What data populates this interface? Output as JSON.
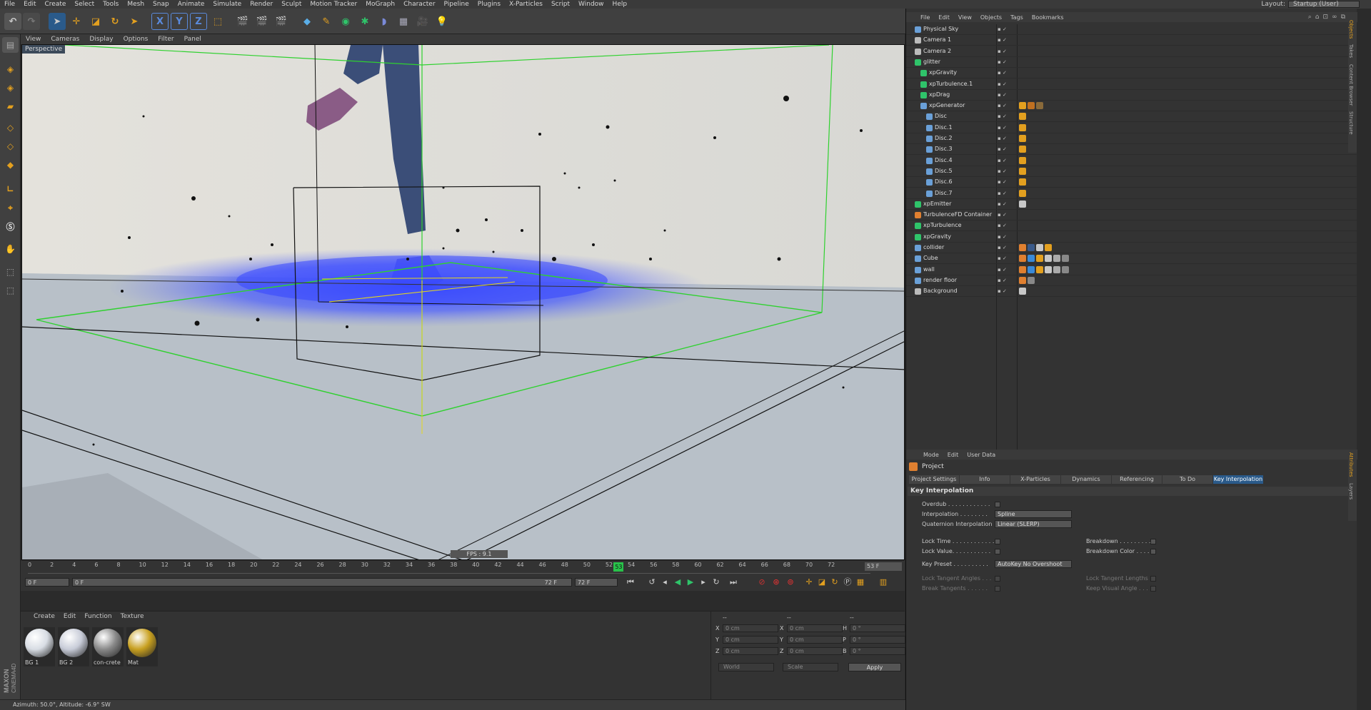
{
  "menubar": {
    "items": [
      "File",
      "Edit",
      "Create",
      "Select",
      "Tools",
      "Mesh",
      "Snap",
      "Animate",
      "Simulate",
      "Render",
      "Sculpt",
      "Motion Tracker",
      "MoGraph",
      "Character",
      "Pipeline",
      "Plugins",
      "X-Particles",
      "Script",
      "Window",
      "Help"
    ],
    "layout_label": "Layout:",
    "layout_value": "Startup (User)"
  },
  "toolbar": {
    "axis_x": "X",
    "axis_y": "Y",
    "axis_z": "Z"
  },
  "viewport": {
    "menu": [
      "View",
      "Cameras",
      "Display",
      "Options",
      "Filter",
      "Panel"
    ],
    "label": "Perspective",
    "fps": "FPS : 9.1"
  },
  "timeline": {
    "ticks": [
      "0",
      "2",
      "4",
      "6",
      "8",
      "10",
      "12",
      "14",
      "16",
      "18",
      "20",
      "22",
      "24",
      "26",
      "28",
      "30",
      "32",
      "34",
      "36",
      "38",
      "40",
      "42",
      "44",
      "46",
      "48",
      "50",
      "52",
      "54",
      "56",
      "58",
      "60",
      "62",
      "64",
      "66",
      "68",
      "70",
      "72"
    ],
    "playhead": "53",
    "frame_end_display": "53 F",
    "start_field": "0 F",
    "min_field": "0 F",
    "max_field": "72 F",
    "end_field": "72 F"
  },
  "materials": {
    "menu": [
      "Create",
      "Edit",
      "Function",
      "Texture"
    ],
    "items": [
      {
        "name": "BG 1",
        "color": "#d8dde4"
      },
      {
        "name": "BG 2",
        "color": "#c8ccd8"
      },
      {
        "name": "con-crete",
        "color": "#8a8a8a"
      },
      {
        "name": "Mat",
        "color": "#c8a020"
      }
    ]
  },
  "coords": {
    "col1": "--",
    "col2": "--",
    "col3": "--",
    "rows": [
      {
        "a1": "X",
        "v1": "0 cm",
        "a2": "X",
        "v2": "0 cm",
        "a3": "H",
        "v3": "0 °"
      },
      {
        "a1": "Y",
        "v1": "0 cm",
        "a2": "Y",
        "v2": "0 cm",
        "a3": "P",
        "v3": "0 °"
      },
      {
        "a1": "Z",
        "v1": "0 cm",
        "a2": "Z",
        "v2": "0 cm",
        "a3": "B",
        "v3": "0 °"
      }
    ],
    "world": "World",
    "scale": "Scale",
    "apply": "Apply"
  },
  "status": {
    "text": "Azimuth: 50.0°, Altitude: -6.9°  SW"
  },
  "objects": {
    "menu": [
      "File",
      "Edit",
      "View",
      "Objects",
      "Tags",
      "Bookmarks"
    ],
    "rows": [
      {
        "name": "Physical Sky",
        "indent": 0,
        "color": "#6aa0d8"
      },
      {
        "name": "Camera 1",
        "indent": 0,
        "color": "#bbbbbb"
      },
      {
        "name": "Camera 2",
        "indent": 0,
        "color": "#bbbbbb"
      },
      {
        "name": "glitter",
        "indent": 0,
        "color": "#2fc46a"
      },
      {
        "name": "xpGravity",
        "indent": 1,
        "color": "#2fc46a"
      },
      {
        "name": "xpTurbulence.1",
        "indent": 1,
        "color": "#2fc46a"
      },
      {
        "name": "xpDrag",
        "indent": 1,
        "color": "#2fc46a"
      },
      {
        "name": "xpGenerator",
        "indent": 1,
        "color": "#6aa0d8"
      },
      {
        "name": "Disc",
        "indent": 2,
        "color": "#6aa0d8"
      },
      {
        "name": "Disc.1",
        "indent": 2,
        "color": "#6aa0d8"
      },
      {
        "name": "Disc.2",
        "indent": 2,
        "color": "#6aa0d8"
      },
      {
        "name": "Disc.3",
        "indent": 2,
        "color": "#6aa0d8"
      },
      {
        "name": "Disc.4",
        "indent": 2,
        "color": "#6aa0d8"
      },
      {
        "name": "Disc.5",
        "indent": 2,
        "color": "#6aa0d8"
      },
      {
        "name": "Disc.6",
        "indent": 2,
        "color": "#6aa0d8"
      },
      {
        "name": "Disc.7",
        "indent": 2,
        "color": "#6aa0d8"
      },
      {
        "name": "xpEmitter",
        "indent": 0,
        "color": "#2fc46a"
      },
      {
        "name": "TurbulenceFD Container",
        "indent": 0,
        "color": "#e08030"
      },
      {
        "name": "xpTurbulence",
        "indent": 0,
        "color": "#2fc46a"
      },
      {
        "name": "xpGravity",
        "indent": 0,
        "color": "#2fc46a"
      },
      {
        "name": "collider",
        "indent": 0,
        "color": "#6aa0d8"
      },
      {
        "name": "Cube",
        "indent": 0,
        "color": "#6aa0d8"
      },
      {
        "name": "wall",
        "indent": 0,
        "color": "#6aa0d8"
      },
      {
        "name": "render floor",
        "indent": 0,
        "color": "#6aa0d8"
      },
      {
        "name": "Background",
        "indent": 0,
        "color": "#bbbbbb"
      }
    ]
  },
  "attributes": {
    "menu": [
      "Mode",
      "Edit",
      "User Data"
    ],
    "title": "Project",
    "tabs": [
      "Project Settings",
      "Info",
      "X-Particles",
      "Dynamics",
      "Referencing",
      "To Do",
      "Key Interpolation"
    ],
    "section": "Key Interpolation",
    "overdub": "Overdub . . . . . . . . . . . .",
    "interpolation": "Interpolation . . . . . . . .",
    "interpolation_value": "Spline",
    "quaternion": "Quaternion Interpolation",
    "quaternion_value": "Linear (SLERP)",
    "lock_time": "Lock Time . . . . . . . . . . . .",
    "lock_value": "Lock Value. . . . . . . . . . .",
    "breakdown": "Breakdown . . . . . . . . .",
    "breakdown_color": "Breakdown Color . . . .",
    "key_preset": "Key Preset . . . . . . . . . .",
    "key_preset_value": "AutoKey No Overshoot",
    "lock_tangent_angles": "Lock Tangent Angles . . .",
    "break_tangents": "Break Tangents . . . . . .",
    "lock_tangent_lengths": "Lock Tangent Lengths",
    "keep_visual_angle": "Keep Visual Angle . . ."
  },
  "side_tabs": {
    "top": [
      "Objects",
      "Takes",
      "Content Browser",
      "Structure"
    ],
    "bottom": [
      "Attributes",
      "Layers"
    ]
  },
  "brand": {
    "logo_top": "MAXON",
    "logo_bottom": "CINEMA4D"
  }
}
